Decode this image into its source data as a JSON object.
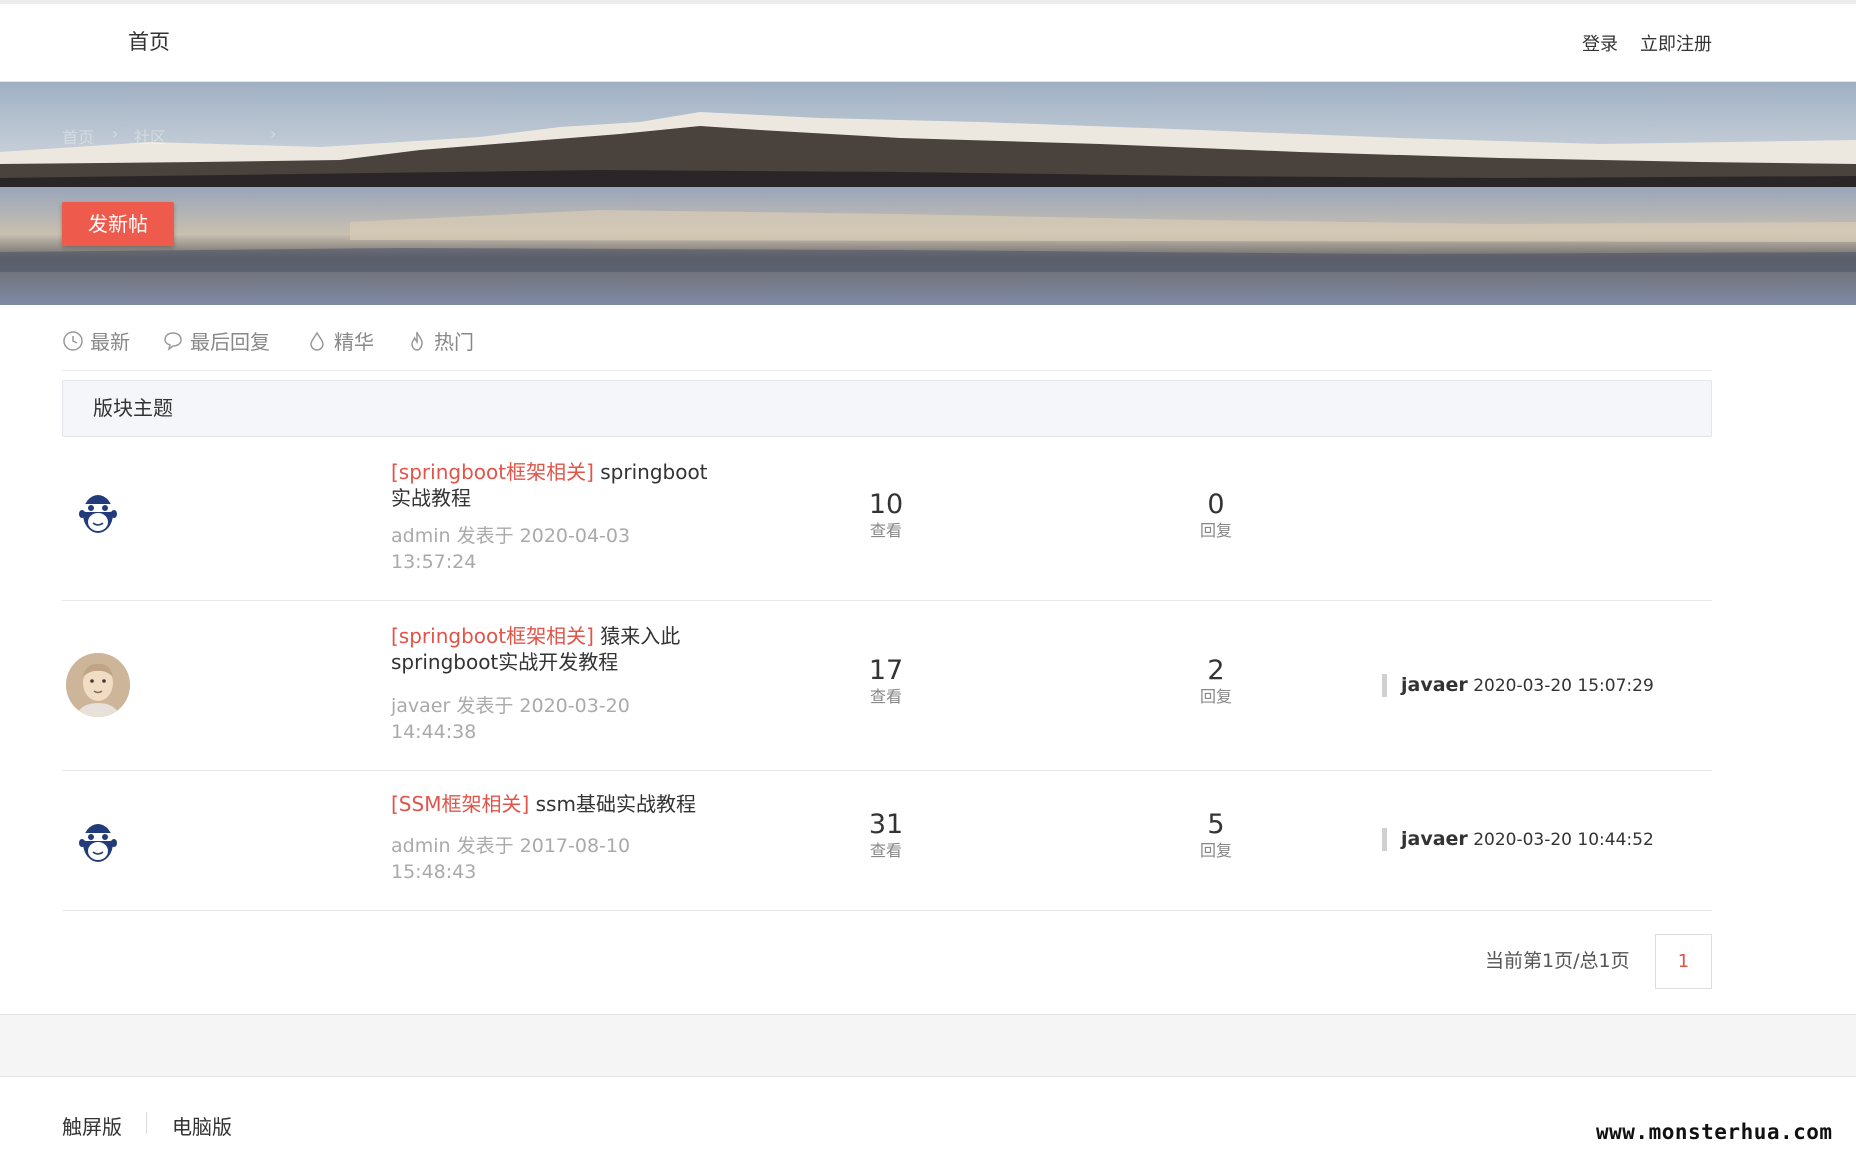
{
  "header": {
    "home": "首页",
    "login": "登录",
    "register": "立即注册"
  },
  "banner": {
    "breadcrumb": [
      "首页",
      "社区"
    ],
    "new_post": "发新帖"
  },
  "tabs": [
    {
      "label": "最新",
      "icon": "clock-icon"
    },
    {
      "label": "最后回复",
      "icon": "speech-bubble-icon"
    },
    {
      "label": "精华",
      "icon": "droplet-icon"
    },
    {
      "label": "热门",
      "icon": "flame-icon"
    }
  ],
  "section": {
    "title": "版块主题"
  },
  "threads": [
    {
      "avatar": "monkey-logo-icon",
      "category": "[springboot框架相关]",
      "title": "springboot实战教程",
      "author": "admin",
      "posted_label": "发表于",
      "posted_at": "2020-04-03 13:57:24",
      "views": "10",
      "views_label": "查看",
      "replies": "0",
      "replies_label": "回复",
      "last_user": "",
      "last_time": ""
    },
    {
      "avatar": "user-photo-avatar",
      "category": "[springboot框架相关]",
      "title": "猿来入此springboot实战开发教程",
      "author": "javaer",
      "posted_label": "发表于",
      "posted_at": "2020-03-20 14:44:38",
      "views": "17",
      "views_label": "查看",
      "replies": "2",
      "replies_label": "回复",
      "last_user": "javaer",
      "last_time": "2020-03-20 15:07:29"
    },
    {
      "avatar": "monkey-logo-icon",
      "category": "[SSM框架相关]",
      "title": "ssm基础实战教程",
      "author": "admin",
      "posted_label": "发表于",
      "posted_at": "2017-08-10 15:48:43",
      "views": "31",
      "views_label": "查看",
      "replies": "5",
      "replies_label": "回复",
      "last_user": "javaer",
      "last_time": "2020-03-20 10:44:52"
    }
  ],
  "pagination": {
    "info": "当前第1页/总1页",
    "current": "1"
  },
  "footer": {
    "touch": "触屏版",
    "pc": "电脑版",
    "watermark": "www.monsterhua.com"
  },
  "colors": {
    "accent": "#ee5a4c",
    "category": "#e2544a"
  }
}
